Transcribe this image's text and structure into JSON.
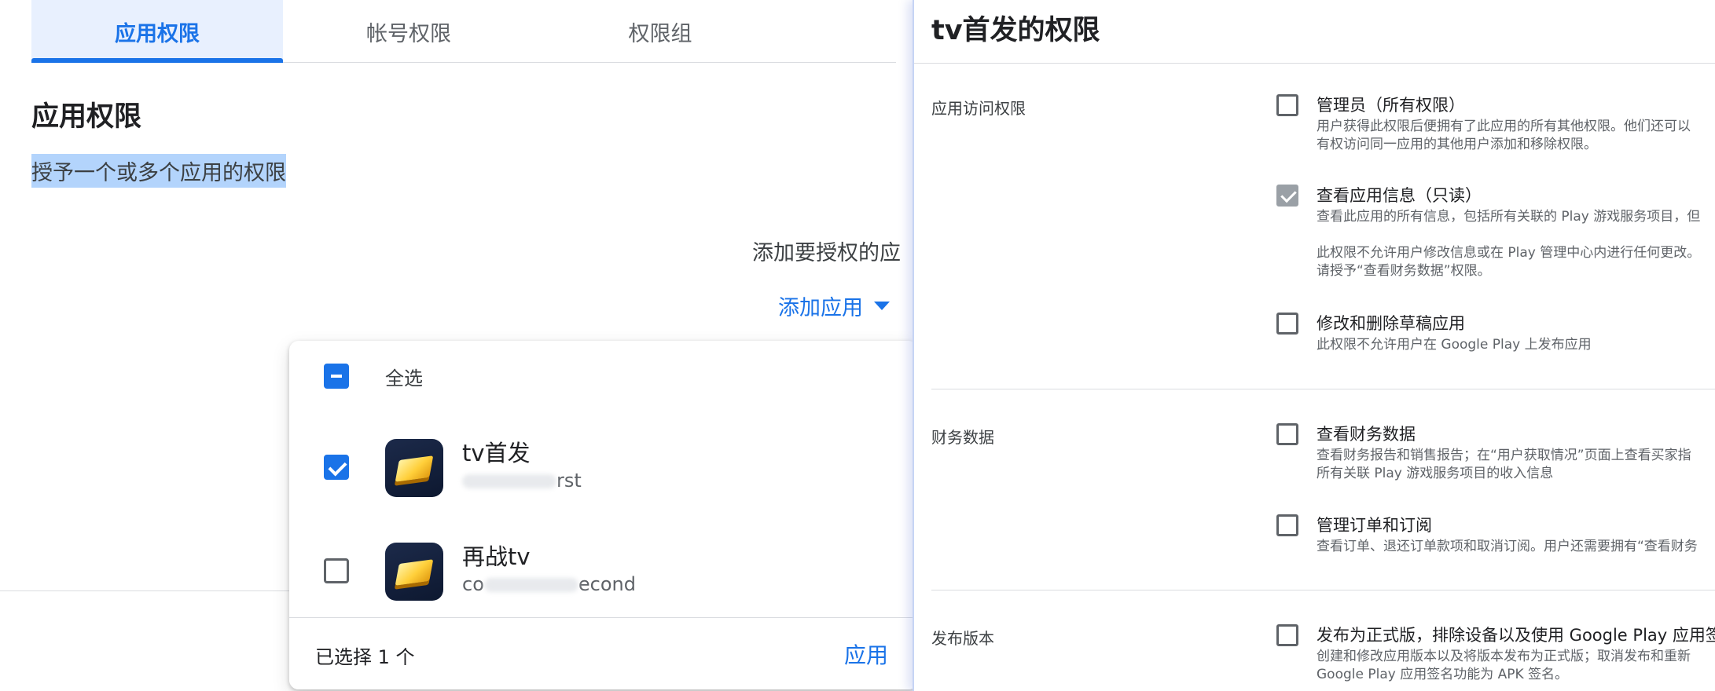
{
  "tabs": [
    {
      "label": "应用权限",
      "active": true
    },
    {
      "label": "帐号权限",
      "active": false
    },
    {
      "label": "权限组",
      "active": false
    }
  ],
  "section": {
    "title": "应用权限",
    "subtitle": "授予一个或多个应用的权限"
  },
  "add_prompt": "添加要授权的应",
  "add_app_button": "添加应用",
  "dropdown": {
    "select_all_label": "全选",
    "apps": [
      {
        "name": "tv首发",
        "package_prefix": "",
        "package_suffix": "rst",
        "checked": true
      },
      {
        "name": "再战tv",
        "package_prefix": "co",
        "package_suffix": "econd",
        "checked": false
      }
    ],
    "selected_count": "已选择 1 个",
    "apply_label": "应用"
  },
  "panel": {
    "title": "tv首发的权限",
    "groups": [
      {
        "label": "应用访问权限",
        "permissions": [
          {
            "title": "管理员（所有权限）",
            "desc": [
              "用户获得此权限后便拥有了此应用的所有其他权限。他们还可以",
              "有权访问同一应用的其他用户添加和移除权限。"
            ],
            "checked": false
          },
          {
            "title": "查看应用信息（只读）",
            "desc": [
              "查看此应用的所有信息，包括所有关联的 Play 游戏服务项目，但",
              "",
              "此权限不允许用户修改信息或在 Play 管理中心内进行任何更改。",
              "请授予“查看财务数据”权限。"
            ],
            "checked": true,
            "disabled": true
          },
          {
            "title": "修改和删除草稿应用",
            "desc": [
              "此权限不允许用户在 Google Play 上发布应用"
            ],
            "checked": false
          }
        ]
      },
      {
        "label": "财务数据",
        "permissions": [
          {
            "title": "查看财务数据",
            "desc": [
              "查看财务报告和销售报告；在“用户获取情况”页面上查看买家指",
              "所有关联 Play 游戏服务项目的收入信息"
            ],
            "checked": false
          },
          {
            "title": "管理订单和订阅",
            "desc": [
              "查看订单、退还订单款项和取消订阅。用户还需要拥有“查看财务"
            ],
            "checked": false
          }
        ]
      },
      {
        "label": "发布版本",
        "permissions": [
          {
            "title": "发布为正式版，排除设备以及使用 Google Play 应用签名",
            "desc": [
              "创建和修改应用版本以及将版本发布为正式版；取消发布和重新",
              "Google Play 应用签名功能为 APK 签名。"
            ],
            "checked": false
          }
        ]
      }
    ]
  },
  "colors": {
    "accent": "#1a73e8",
    "tab_active_bg": "#e8f0fe",
    "selection_highlight": "#b3d4fc",
    "disabled_checkbox": "#9aa0a6"
  }
}
